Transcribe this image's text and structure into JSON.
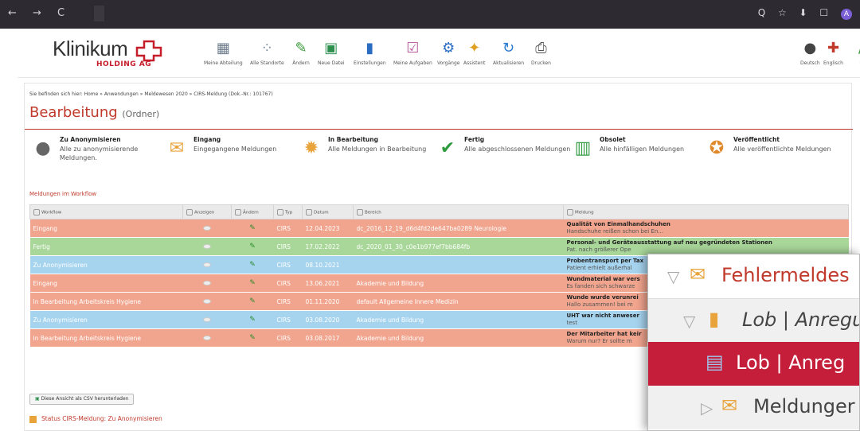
{
  "browser": {
    "nav": "← → C",
    "icons": "Q ☆ ⬇ ☐",
    "profile": "A"
  },
  "toolbar": {
    "logo_main": "Klinikum",
    "logo_sub": "HOLDING AG",
    "items": [
      "Meine Abteilung",
      "Alle Standorte",
      "Ändern",
      "Neue Datei",
      "Einstellungen",
      "Meine Aufgaben",
      "Vorgänge",
      "Assistent",
      "Aktualisieren",
      "Drucken"
    ],
    "right_items": [
      "Deutsch",
      "Englisch",
      "L"
    ]
  },
  "breadcrumb": "Sie befinden sich hier:  Home » Anwendungen » Meldewesen 2020 » CIRS-Meldung (Dok.-Nr.: 101767)",
  "title": "Bearbeitung",
  "title_suffix": "(Ordner)",
  "tabs": [
    {
      "title": "Zu Anonymisieren",
      "sub": "Alle zu anonymisierende Meldungen."
    },
    {
      "title": "Eingang",
      "sub": "Eingegangene Meldungen"
    },
    {
      "title": "In Bearbeitung",
      "sub": "Alle Meldungen in Bearbeitung"
    },
    {
      "title": "Fertig",
      "sub": "Alle abgeschlossenen Meldungen"
    },
    {
      "title": "Obsolet",
      "sub": "Alle hinfälligen Meldungen"
    },
    {
      "title": "Veröffentlicht",
      "sub": "Alle veröffentlichte Meldungen"
    }
  ],
  "workflow_heading": "Meldungen im Workflow",
  "table": {
    "headers": [
      "Workflow",
      "Anzeigen",
      "Ändern",
      "Typ",
      "Datum",
      "Bereich",
      "Meldung"
    ],
    "rows": [
      {
        "workflow": "Eingang",
        "typ": "CIRS",
        "datum": "12.04.2023",
        "bereich": "dc_2016_12_19_d6d4fd2de647ba0289 Neurologie",
        "meldung_title": "Qualität von Einmalhandschuhen",
        "meldung_text": "Handschuhe reißen schon bei En...",
        "color": "#f2a58e"
      },
      {
        "workflow": "Fertig",
        "typ": "CIRS",
        "datum": "17.02.2022",
        "bereich": "dc_2020_01_30_c0e1b977ef7bb684fb",
        "meldung_title": "Personal- und Geräteausstattung auf neu gegründeten Stationen",
        "meldung_text": "Pat. nach größerer Ope",
        "color": "#a9d79a"
      },
      {
        "workflow": "Zu Anonymisieren",
        "typ": "CIRS",
        "datum": "08.10.2021",
        "bereich": "",
        "meldung_title": "Probentransport per Tax",
        "meldung_text": "Patient erhielt außerhal",
        "color": "#a6d4ef"
      },
      {
        "workflow": "Eingang",
        "typ": "CIRS",
        "datum": "13.06.2021",
        "bereich": "Akademie und Bildung",
        "meldung_title": "Wundmaterial war vers",
        "meldung_text": "Es fanden sich schwarze",
        "color": "#f2a58e"
      },
      {
        "workflow": "In Bearbeitung Arbeitskreis Hygiene",
        "typ": "CIRS",
        "datum": "01.11.2020",
        "bereich": "default Allgemeine Innere Medizin",
        "meldung_title": "Wunde wurde verunrei",
        "meldung_text": "Hallo zusammen! bei m",
        "color": "#f2a58e"
      },
      {
        "workflow": "Zu Anonymisieren",
        "typ": "CIRS",
        "datum": "03.08.2020",
        "bereich": "Akademie und Bildung",
        "meldung_title": "UHT war nicht anweser",
        "meldung_text": "test",
        "color": "#a6d4ef"
      },
      {
        "workflow": "In Bearbeitung Arbeitskreis Hygiene",
        "typ": "CIRS",
        "datum": "03.08.2017",
        "bereich": "Akademie und Bildung",
        "meldung_title": "Der Mitarbeiter hat keir",
        "meldung_text": "Warum nur? Er sollte m",
        "color": "#f2a58e"
      }
    ]
  },
  "csv_button": "Diese Ansicht als CSV herunterladen",
  "status": "Status CIRS-Meldung: Zu Anonymisieren",
  "zoom": {
    "rows": [
      {
        "label": "Fehlermeldes",
        "color": "#c0392b"
      },
      {
        "label": "Lob | Anregu",
        "color": "#444"
      },
      {
        "label": "Lob | Anreg",
        "color": "#ffffff"
      },
      {
        "label": "Meldunger",
        "color": "#444"
      }
    ]
  },
  "colors": {
    "accent": "#c0392b",
    "eingang": "#f2a58e",
    "fertig": "#a9d79a",
    "anonym": "#a6d4ef",
    "zoom_selected": "#c41e3a"
  }
}
